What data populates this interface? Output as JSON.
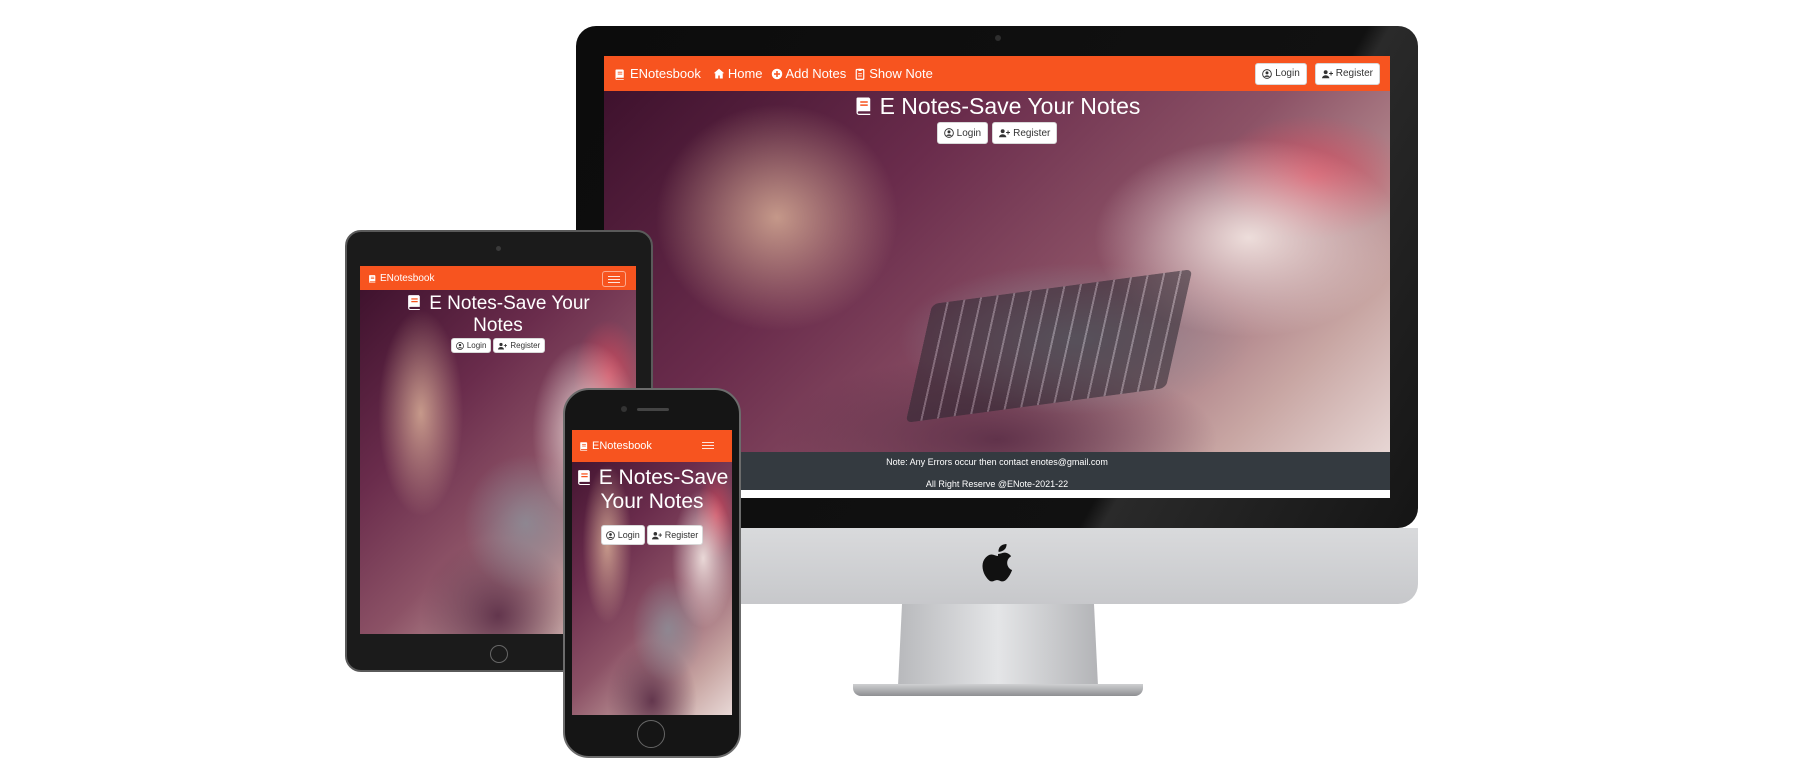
{
  "brand": "ENotesbook",
  "nav": {
    "home": "Home",
    "add_notes": "Add Notes",
    "show_note": "Show Note",
    "login": "Login",
    "register": "Register"
  },
  "hero": {
    "title": "E Notes-Save Your Notes",
    "tablet_title_line1": "E Notes-Save Your",
    "tablet_title_line2": "Notes",
    "phone_title_line1": "E Notes-Save",
    "phone_title_line2": "Your Notes",
    "login_button": "Login",
    "register_button": "Register"
  },
  "footer": {
    "note": "Note: Any Errors occur then contact enotes@gmail.com",
    "copyright": "All Right Reserve @ENote-2021-22"
  },
  "colors": {
    "navbar": "#f7541f",
    "footer": "#343a40"
  },
  "icons": [
    "book-icon",
    "home-icon",
    "plus-circle-icon",
    "clipboard-icon",
    "user-circle-icon",
    "user-plus-icon",
    "hamburger-icon",
    "apple-logo-icon"
  ]
}
